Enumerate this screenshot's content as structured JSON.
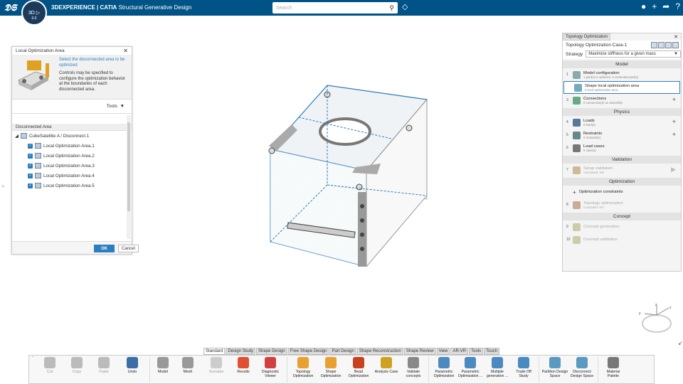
{
  "topbar": {
    "brand": "3D",
    "product_bold": "EXPERIENCE | CATIA",
    "product_rest": " Structural Generative Design",
    "compass_ver": "6.0",
    "search_placeholder": "Search"
  },
  "left_panel": {
    "title": "Local Optimization Area",
    "link_text": "Select the disconnected area to be optimized",
    "desc": "Controls may be specified to configure the optimization behavior at the boundaries of each disconnected area.",
    "tools_label": "Tools",
    "section": "Disconnected Area",
    "root": "CubeSatellite A / Disconnect.1",
    "items": [
      "Local Optimization Area.1",
      "Local Optimization Area.2",
      "Local Optimization Area.3",
      "Local Optimization Area.4",
      "Local Optimization Area.5"
    ],
    "ok": "OK",
    "cancel": "Cancel"
  },
  "right_panel": {
    "tab": "Topology Optimization",
    "case": "Topology Optimization Case.1",
    "strategy_label": "Strategy",
    "strategy_value": "Maximize stiffness for a given mass",
    "sections": {
      "model": "Model",
      "physics": "Physics",
      "validation": "Validation",
      "optimization": "Optimization",
      "concept": "Concept"
    },
    "rows": [
      {
        "n": "1",
        "t1": "Model configuration",
        "t2": "1 part(s) to optimize, 0 contextual part(s)"
      },
      {
        "n": "",
        "t1": "Shape local optimization area",
        "t2": "5 local optimization area"
      },
      {
        "n": "3",
        "t1": "Connections",
        "t2": "0 connection(s) on assembly"
      },
      {
        "n": "4",
        "t1": "Loads",
        "t2": "0 load(s)"
      },
      {
        "n": "5",
        "t1": "Restraints",
        "t2": "0 restraint(s)"
      },
      {
        "n": "6",
        "t1": "Load cases",
        "t2": "0 case(s)"
      },
      {
        "n": "7",
        "t1": "Setup validation",
        "t2": "Calculated: NO"
      },
      {
        "n": "",
        "t1": "Optimization constraints",
        "t2": ""
      },
      {
        "n": "8",
        "t1": "Topology optimization",
        "t2": "Computed: NO"
      },
      {
        "n": "9",
        "t1": "Concept generation",
        "t2": ""
      },
      {
        "n": "10",
        "t1": "Concept validation",
        "t2": ""
      }
    ]
  },
  "ribbon": {
    "tabs": [
      "Standard",
      "Design Study",
      "Shape Design",
      "Free Shape Design",
      "Part Design",
      "Shape Reconstruction",
      "Shape Review",
      "View",
      "AR-VR",
      "Tools",
      "Touch"
    ],
    "tools": [
      {
        "l": "Cut",
        "c": "#bbb"
      },
      {
        "l": "Copy",
        "c": "#bbb"
      },
      {
        "l": "Paste",
        "c": "#bbb"
      },
      {
        "l": "Undo",
        "c": "#3a6ea5"
      },
      {
        "l": "Model",
        "c": "#999"
      },
      {
        "l": "Mesh",
        "c": "#999"
      },
      {
        "l": "Scenario",
        "c": "#ccc"
      },
      {
        "l": "Results",
        "c": "#e05030"
      },
      {
        "l": "Diagnostic Viewer",
        "c": "#d04040"
      },
      {
        "l": "Topology Optimization",
        "c": "#e8a030"
      },
      {
        "l": "Shape Optimization",
        "c": "#e8a030"
      },
      {
        "l": "Bead Optimization",
        "c": "#c84020"
      },
      {
        "l": "Analysis Case",
        "c": "#d0a020"
      },
      {
        "l": "Validate concepts",
        "c": "#888"
      },
      {
        "l": "Parametric Optimization",
        "c": "#4a8ac0"
      },
      {
        "l": "Parametric Optimization ...",
        "c": "#4a8ac0"
      },
      {
        "l": "Multiple generation ...",
        "c": "#4a8ac0"
      },
      {
        "l": "Trade Off Study",
        "c": "#4a8ac0"
      },
      {
        "l": "Partition Design Space",
        "c": "#5a9ac0"
      },
      {
        "l": "Disconnect Design Space",
        "c": "#5a9ac0"
      },
      {
        "l": "Material Palette",
        "c": "#777"
      }
    ]
  }
}
